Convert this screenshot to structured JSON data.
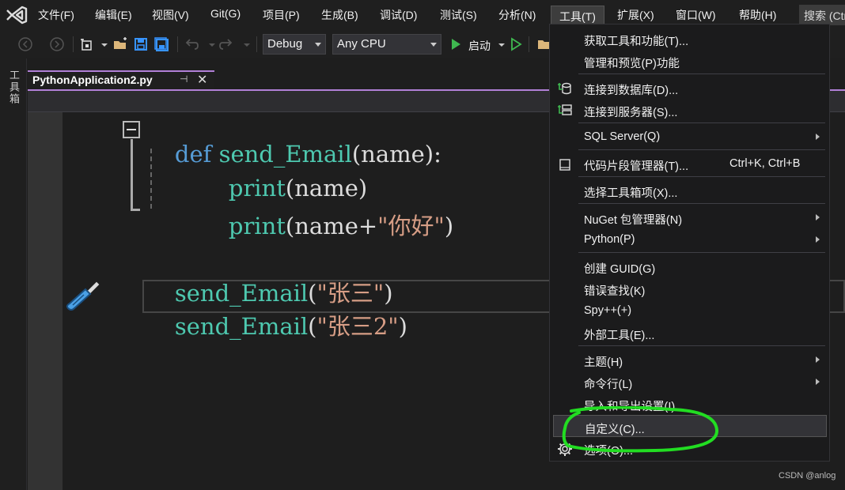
{
  "menubar": {
    "items": [
      "文件(F)",
      "编辑(E)",
      "视图(V)",
      "Git(G)",
      "项目(P)",
      "生成(B)",
      "调试(D)",
      "测试(S)",
      "分析(N)",
      "工具(T)",
      "扩展(X)",
      "窗口(W)",
      "帮助(H)"
    ],
    "search": "搜索 (Ctrl"
  },
  "toolbar": {
    "config": "Debug",
    "platform": "Any CPU",
    "start": "启动"
  },
  "toolbox": {
    "label": "工具箱"
  },
  "tab": {
    "label": "PythonApplication2.py",
    "pin": "⊣",
    "close": "✕"
  },
  "code": {
    "l1_kw": "def",
    "l1_fn": "send_Email",
    "l1_rest": "(name):",
    "l2_fn": "print",
    "l2_rest": "(name)",
    "l3_fn": "print",
    "l3_rest": "(name+",
    "l3_str": "\"你好\"",
    "l3_end": ")",
    "l4_fn": "send_Email",
    "l4_open": "(",
    "l4_str": "\"张三\"",
    "l4_close": ")",
    "l5_fn": "send_Email",
    "l5_open": "(",
    "l5_str": "\"张三2\"",
    "l5_close": ")"
  },
  "dropdown": {
    "items": [
      {
        "label": "获取工具和功能(T)..."
      },
      {
        "label": "管理和预览(P)功能"
      },
      {
        "label": "连接到数据库(D)..."
      },
      {
        "label": "连接到服务器(S)..."
      },
      {
        "label": "SQL Server(Q)"
      },
      {
        "label": "代码片段管理器(T)...",
        "shortcut": "Ctrl+K, Ctrl+B"
      },
      {
        "label": "选择工具箱项(X)..."
      },
      {
        "label": "NuGet 包管理器(N)"
      },
      {
        "label": "Python(P)"
      },
      {
        "label": "创建 GUID(G)"
      },
      {
        "label": "错误查找(K)"
      },
      {
        "label": "Spy++(+)"
      },
      {
        "label": "外部工具(E)..."
      },
      {
        "label": "主题(H)"
      },
      {
        "label": "命令行(L)"
      },
      {
        "label": "导入和导出设置(I)..."
      },
      {
        "label": "自定义(C)..."
      },
      {
        "label": "选项(O)..."
      }
    ]
  },
  "watermark": "CSDN @anlog",
  "colors": {
    "accent": "#b180d7",
    "keyword": "#569cd6",
    "function": "#4ec9b0",
    "string": "#d69d85",
    "highlight": "#22dd22"
  }
}
